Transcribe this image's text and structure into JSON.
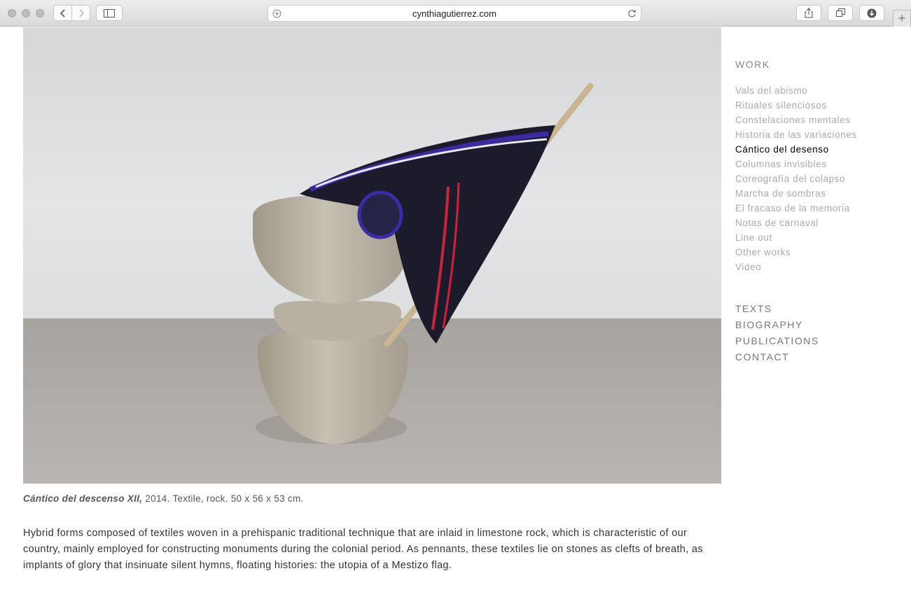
{
  "browser": {
    "url": "cynthiagutierrez.com"
  },
  "artwork": {
    "caption_title": "Cántico del descenso XII,",
    "caption_details": " 2014. Textile, rock. 50 x 56 x 53 cm.",
    "description": "Hybrid forms composed of textiles woven in a prehispanic traditional technique that are inlaid in limestone rock, which is characteristic of our country, mainly employed for constructing monuments during the colonial period. As pennants, these textiles lie on stones as clefts of breath, as implants of glory that insinuate silent hymns, floating histories: the utopia of a Mestizo flag."
  },
  "nav": {
    "work_heading": "WORK",
    "works": [
      "Vals del abismo",
      "Rituales silenciosos",
      "Constelaciones mentales",
      "Historia de las variaciones",
      "Cántico del desenso",
      "Columnas invisibles",
      "Coreografía del colapso",
      "Marcha de sombras",
      "El fracaso de la memoria",
      "Notas de carnaval",
      "Line out",
      "Other works",
      "Video"
    ],
    "active_work": "Cántico del desenso",
    "sections": [
      "TEXTS",
      "BIOGRAPHY",
      "PUBLICATIONS",
      "CONTACT"
    ]
  }
}
